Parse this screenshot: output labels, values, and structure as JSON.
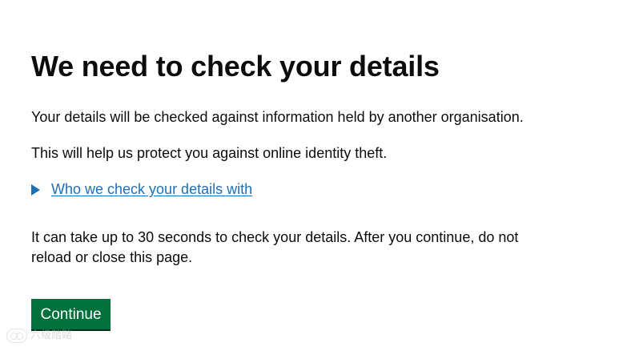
{
  "heading": "We need to check your details",
  "paragraphs": {
    "p1": "Your details will be checked against information held by another organisation.",
    "p2": "This will help us protect you against online identity theft.",
    "p3": "It can take up to 30 seconds to check your details. After you continue, do not reload or close this page."
  },
  "details": {
    "summary_label": "Who we check your details with",
    "icon": "caret-right-icon"
  },
  "actions": {
    "continue_label": "Continue"
  },
  "colors": {
    "link": "#1d70b8",
    "button": "#00703c",
    "text": "#0b0c0c"
  },
  "watermark": {
    "text": "六级踏踏",
    "icon": "watermark-logo-icon"
  }
}
